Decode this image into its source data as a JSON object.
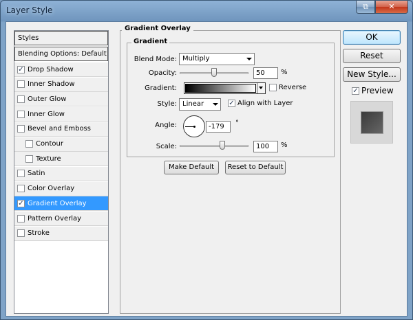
{
  "window": {
    "title": "Layer Style",
    "restore_glyph": "⧉",
    "close_glyph": "✕"
  },
  "styles_list": {
    "header": "Styles",
    "blending": "Blending Options: Default",
    "items": [
      {
        "label": "Drop Shadow",
        "checked": true
      },
      {
        "label": "Inner Shadow",
        "checked": false
      },
      {
        "label": "Outer Glow",
        "checked": false
      },
      {
        "label": "Inner Glow",
        "checked": false
      },
      {
        "label": "Bevel and Emboss",
        "checked": false
      },
      {
        "label": "Contour",
        "checked": false
      },
      {
        "label": "Texture",
        "checked": false
      },
      {
        "label": "Satin",
        "checked": false
      },
      {
        "label": "Color Overlay",
        "checked": false
      },
      {
        "label": "Gradient Overlay",
        "checked": true,
        "selected": true
      },
      {
        "label": "Pattern Overlay",
        "checked": false
      },
      {
        "label": "Stroke",
        "checked": false
      }
    ]
  },
  "panel": {
    "title": "Gradient Overlay",
    "section": "Gradient",
    "blend_mode_label": "Blend Mode:",
    "blend_mode_value": "Multiply",
    "opacity_label": "Opacity:",
    "opacity_value": "50",
    "opacity_unit": "%",
    "gradient_label": "Gradient:",
    "reverse_label": "Reverse",
    "reverse_checked": false,
    "style_label": "Style:",
    "style_value": "Linear",
    "align_label": "Align with Layer",
    "align_checked": true,
    "angle_label": "Angle:",
    "angle_value": "-179",
    "angle_unit": "°",
    "scale_label": "Scale:",
    "scale_value": "100",
    "scale_unit": "%",
    "make_default": "Make Default",
    "reset_default": "Reset to Default"
  },
  "actions": {
    "ok": "OK",
    "reset": "Reset",
    "new_style": "New Style...",
    "preview_label": "Preview",
    "preview_checked": true
  },
  "check_glyph": "✓"
}
